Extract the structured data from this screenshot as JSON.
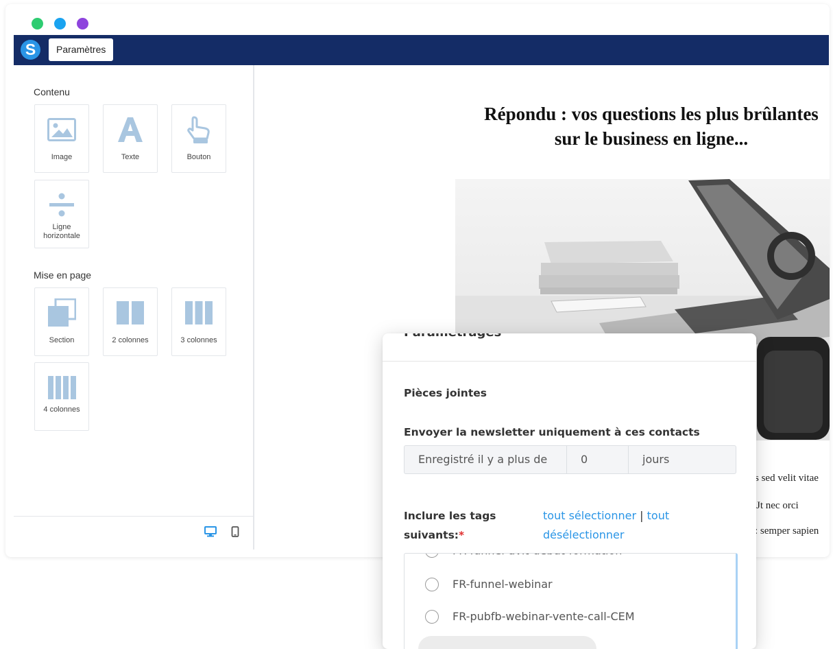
{
  "window": {
    "dots": [
      {
        "name": "green",
        "color": "#2ecc71"
      },
      {
        "name": "blue",
        "color": "#1aa3f0"
      },
      {
        "name": "purple",
        "color": "#8e44dd"
      }
    ]
  },
  "topbar": {
    "logo_letter": "S",
    "tab_label": "Paramètres",
    "background": "#142c66"
  },
  "sidebar": {
    "contenu_title": "Contenu",
    "contenu_items": [
      {
        "label": "Image",
        "icon": "image-icon"
      },
      {
        "label": "Texte",
        "icon": "text-icon"
      },
      {
        "label": "Bouton",
        "icon": "pointer-hand-icon"
      },
      {
        "label": "Ligne horizontale",
        "icon": "divider-icon"
      }
    ],
    "layout_title": "Mise en page",
    "layout_items": [
      {
        "label": "Section",
        "icon": "section-icon"
      },
      {
        "label": "2 colonnes",
        "icon": "two-columns-icon"
      },
      {
        "label": "3 colonnes",
        "icon": "three-columns-icon"
      },
      {
        "label": "4 colonnes",
        "icon": "four-columns-icon"
      }
    ],
    "icon_color": "#a9c6e0",
    "device_icons": [
      "desktop-icon",
      "mobile-icon"
    ]
  },
  "preview": {
    "headline_line1": "Répondu : vos questions les plus brûlantes",
    "headline_line2": "sur le business en ligne...",
    "body_lines": [
      "s sed velit vitae",
      "Jt nec orci",
      ": semper sapien"
    ]
  },
  "settings_modal": {
    "title": "Paramétrages",
    "attachments_label": "Pièces jointes",
    "send_only_label": "Envoyer la newsletter uniquement à ces contacts",
    "registered_prefix": "Enregistré il y a plus de",
    "days_value": "0",
    "days_unit": "jours",
    "tags_label_line1": "Inclure les tags",
    "tags_label_line2": "suivants:",
    "required_mark": "*",
    "select_all": "tout sélectionner",
    "separator": "|",
    "deselect_all_line1": "tout",
    "deselect_all_line2": "désélectionner",
    "tags": [
      "FR-funnel-avit-debut-formation",
      "FR-funnel-webinar",
      "FR-pubfb-webinar-vente-call-CEM"
    ]
  }
}
